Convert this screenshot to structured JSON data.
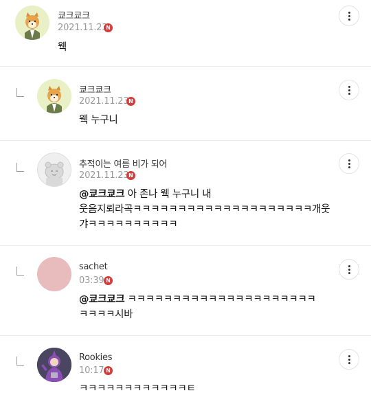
{
  "comments": [
    {
      "author": "쿄크쿄크",
      "date": "2021.11.23",
      "badge": "N",
      "mention": "",
      "text": "웩",
      "avatar": "shiba-dog-avatar",
      "is_reply": false
    },
    {
      "author": "쿄크쿄크",
      "date": "2021.11.23",
      "badge": "N",
      "mention": "",
      "text": "웩 누구니",
      "avatar": "shiba-dog-avatar",
      "is_reply": true
    },
    {
      "author": "추적이는 여름 비가 되어",
      "date": "2021.11.23",
      "badge": "N",
      "mention": "@쿄크쿄크",
      "text_line1": " 아 존나 웩 누구니 내",
      "text_line2": "웃음지뢰라곡ㅋㅋㅋㅋㅋㅋㅋㅋㅋㅋㅋㅋㅋㅋㅋㅋㅋㅋㅋㅋ개웃",
      "text_line3": "갸ㅋㅋㅋㅋㅋㅋㅋㅋㅋㅋ",
      "avatar": "default-gray-avatar",
      "is_reply": true
    },
    {
      "author": "sachet",
      "date": "03:39",
      "badge": "N",
      "mention": "@쿄크쿄크",
      "text_line1": " ㅋㅋㅋㅋㅋㅋㅋㅋㅋㅋㅋㅋㅋㅋㅋㅋㅋㅋㅋㅋㅋ",
      "text_line2": "ㅋㅋㅋㅋ시바",
      "avatar": "pink-circle-avatar",
      "is_reply": true
    },
    {
      "author": "Rookies",
      "date": "10:17",
      "badge": "N",
      "mention": "",
      "text": "ㅋㅋㅋㅋㅋㅋㅋㅋㅋㅋㅋㅋㅌ",
      "avatar": "teletubby-avatar",
      "is_reply": true
    }
  ],
  "icons": {
    "more": "more-vertical-icon",
    "reply": "reply-arrow-icon",
    "new_badge": "new-badge-icon"
  },
  "colors": {
    "badge": "#d43b3b",
    "date": "#999999",
    "divider": "#ebebeb",
    "avatar_yellow": "#e9f0c6",
    "avatar_pink": "#e8bcbc"
  }
}
